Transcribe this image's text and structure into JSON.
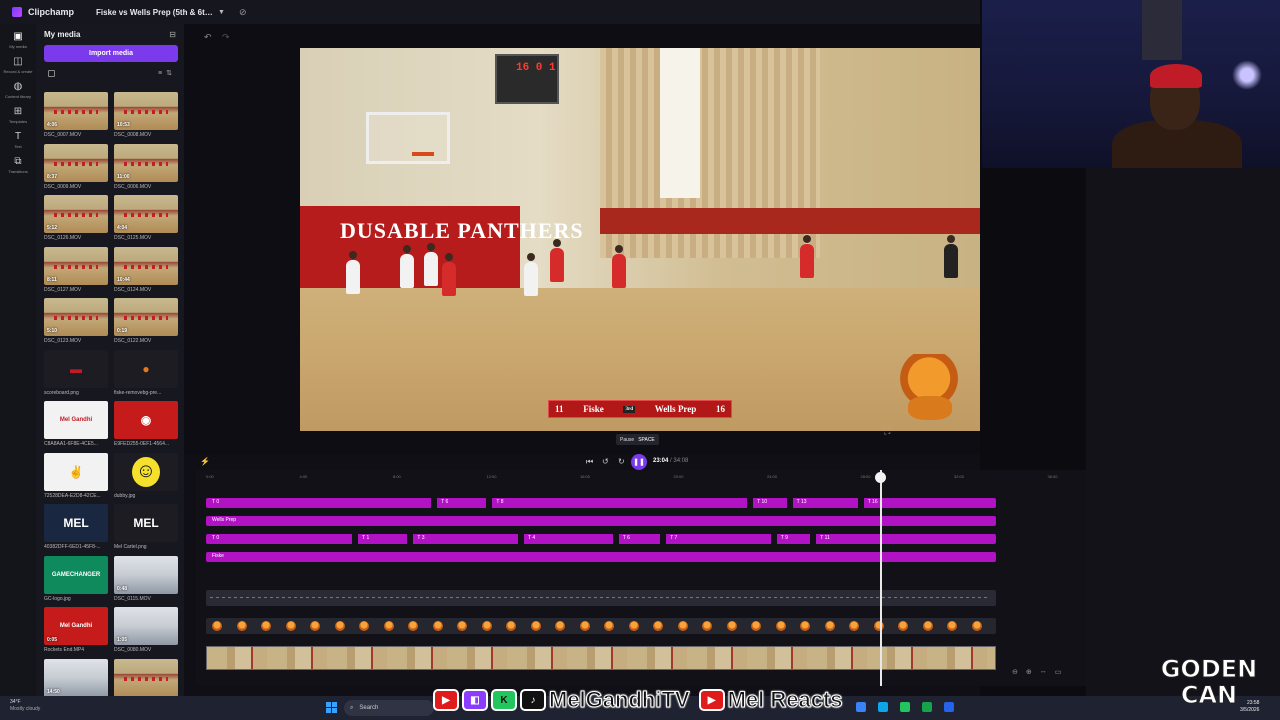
{
  "titlebar": {
    "app_name": "Clipchamp",
    "project_name": "Fiske vs Wells Prep (5th & 6th Gra...",
    "caret": "▼",
    "icon": "cloud-sync-icon"
  },
  "rail": {
    "items": [
      {
        "label": "My media",
        "icon": "folder-icon",
        "glyph": "▣"
      },
      {
        "label": "Record & create",
        "icon": "record-icon",
        "glyph": "◫"
      },
      {
        "label": "Content library",
        "icon": "library-icon",
        "glyph": "◍"
      },
      {
        "label": "Templates",
        "icon": "templates-icon",
        "glyph": "⊞"
      },
      {
        "label": "Text",
        "icon": "text-icon",
        "glyph": "T"
      },
      {
        "label": "Transitions",
        "icon": "transitions-icon",
        "glyph": "⧉"
      }
    ]
  },
  "media": {
    "title": "My media",
    "import_label": "Import media",
    "items": [
      {
        "name": "DSC_0007.MOV",
        "duration": "4:06",
        "style": "gym",
        "symbol": ""
      },
      {
        "name": "DSC_0008.MOV",
        "duration": "10:53",
        "style": "gym",
        "symbol": ""
      },
      {
        "name": "DSC_0009.MOV",
        "duration": "8:37",
        "style": "gym",
        "symbol": ""
      },
      {
        "name": "DSC_0006.MOV",
        "duration": "11:00",
        "style": "gym",
        "symbol": ""
      },
      {
        "name": "DSC_0126.MOV",
        "duration": "5:12",
        "style": "gym",
        "symbol": ""
      },
      {
        "name": "DSC_0125.MOV",
        "duration": "4:04",
        "style": "gym",
        "symbol": ""
      },
      {
        "name": "DSC_0127.MOV",
        "duration": "8:11",
        "style": "gym",
        "symbol": ""
      },
      {
        "name": "DSC_0124.MOV",
        "duration": "10:44",
        "style": "gym",
        "symbol": ""
      },
      {
        "name": "DSC_0123.MOV",
        "duration": "5:10",
        "style": "gym",
        "symbol": ""
      },
      {
        "name": "DSC_0122.MOV",
        "duration": "0:19",
        "style": "gym",
        "symbol": ""
      },
      {
        "name": "scoreboard.png",
        "duration": "",
        "style": "dark",
        "symbol": "▬"
      },
      {
        "name": "fiske-removebg-pre...",
        "duration": "",
        "style": "dark",
        "symbol": "●"
      },
      {
        "name": "C8A8AA1-6F8E-4CE5...",
        "duration": "",
        "style": "white",
        "symbol": "Mel Gandhi"
      },
      {
        "name": "E9FED255-0EF1-4564...",
        "duration": "",
        "style": "red",
        "symbol": "◉"
      },
      {
        "name": "72528DEA-E2D8-42CE...",
        "duration": "",
        "style": "white",
        "symbol": "✌"
      },
      {
        "name": "dubby.jpg",
        "duration": "",
        "style": "dark",
        "symbol": "☺"
      },
      {
        "name": "40382DFF-6ED1-45F8-...",
        "duration": "",
        "style": "navy",
        "symbol": "MEL"
      },
      {
        "name": "Mel Cartel.png",
        "duration": "",
        "style": "dark",
        "symbol": "MEL"
      },
      {
        "name": "GC-logo.jpg",
        "duration": "",
        "style": "green",
        "symbol": "GAMECHANGER"
      },
      {
        "name": "DSC_0115.MOV",
        "duration": "0:48",
        "style": "people",
        "symbol": ""
      },
      {
        "name": "Rockets End.MP4",
        "duration": "0:05",
        "style": "red",
        "symbol": "Mel Gandhi"
      },
      {
        "name": "DSC_0080.MOV",
        "duration": "1:05",
        "style": "people",
        "symbol": ""
      },
      {
        "name": "",
        "duration": "14:50",
        "style": "people",
        "symbol": ""
      },
      {
        "name": "",
        "duration": "",
        "style": "gym",
        "symbol": ""
      }
    ]
  },
  "preview": {
    "banner_text": "DUSABLE PANTHERS",
    "scoreboard_text": "16 0 1",
    "scorebug": {
      "home_score": "11",
      "home_team": "Fiske",
      "period": "3rd",
      "away_team": "Wells Prep",
      "away_score": "16"
    }
  },
  "tooltip": {
    "label": "Pause",
    "shortcut": "SPACE"
  },
  "playback": {
    "current": "23:04",
    "total": "34:08"
  },
  "timeline": {
    "ruler": [
      "0:00",
      "4:00",
      "8:00",
      "12:00",
      "16:00",
      "20:00",
      "24:00",
      "28:00",
      "32:00",
      "36:00"
    ],
    "tracks": [
      {
        "segments": [
          {
            "label": "T 0",
            "start": 0
          },
          {
            "label": "T 6",
            "start": 0.29
          },
          {
            "label": "T 8",
            "start": 0.36
          },
          {
            "label": "T 10",
            "start": 0.69
          },
          {
            "label": "T 13",
            "start": 0.74
          },
          {
            "label": "T 16",
            "start": 0.83
          }
        ]
      },
      {
        "segments": [
          {
            "label": "Wells Prep",
            "start": 0
          }
        ]
      },
      {
        "segments": [
          {
            "label": "T 0",
            "start": 0
          },
          {
            "label": "T 1",
            "start": 0.19
          },
          {
            "label": "T 3",
            "start": 0.26
          },
          {
            "label": "T 4",
            "start": 0.4
          },
          {
            "label": "T 6",
            "start": 0.52
          },
          {
            "label": "T 7",
            "start": 0.58
          },
          {
            "label": "T 9",
            "start": 0.72
          },
          {
            "label": "T 11",
            "start": 0.77
          }
        ]
      },
      {
        "segments": [
          {
            "label": "Fiske",
            "start": 0
          }
        ]
      }
    ]
  },
  "overlay": {
    "social_handle_1": "MelGandhiTV",
    "social_handle_2": "Mel Reacts",
    "brand": "GODEN CAN"
  },
  "taskbar": {
    "temperature": "34°F",
    "condition": "Mostly cloudy",
    "search_label": "Search",
    "time": "23:58",
    "date": "3/5/2026"
  }
}
